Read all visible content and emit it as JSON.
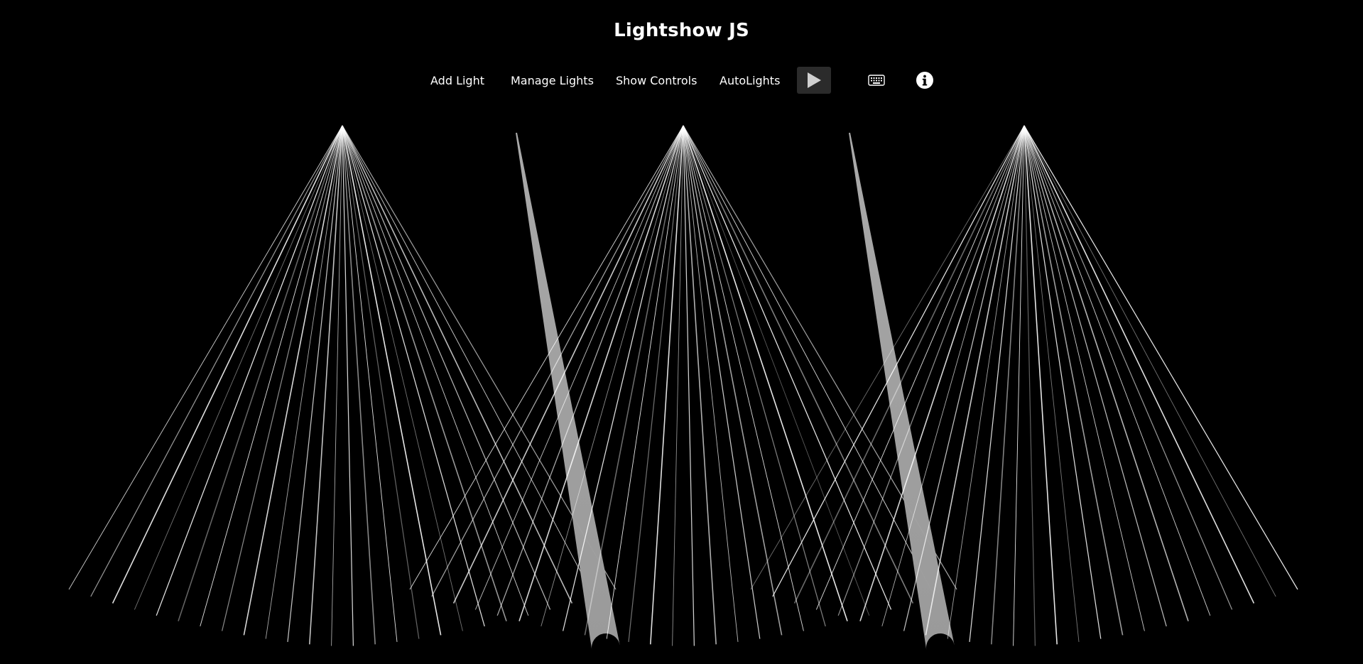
{
  "app": {
    "title": "Lightshow JS"
  },
  "toolbar": {
    "add_light_label": "Add Light",
    "manage_lights_label": "Manage Lights",
    "show_controls_label": "Show Controls",
    "autolights_label": "AutoLights",
    "play_icon": "play-icon",
    "keyboard_icon": "keyboard-icon",
    "info_icon": "info-icon"
  },
  "colors": {
    "background": "#000000",
    "text": "#ffffff",
    "play_button_bg": "#2b2b2b",
    "beam": "#ffffff",
    "spot_beam": "#9a9a9a"
  },
  "lights": [
    {
      "type": "fan",
      "beam_count": 26
    },
    {
      "type": "spot"
    },
    {
      "type": "fan",
      "beam_count": 26
    },
    {
      "type": "spot"
    },
    {
      "type": "fan",
      "beam_count": 26
    }
  ]
}
